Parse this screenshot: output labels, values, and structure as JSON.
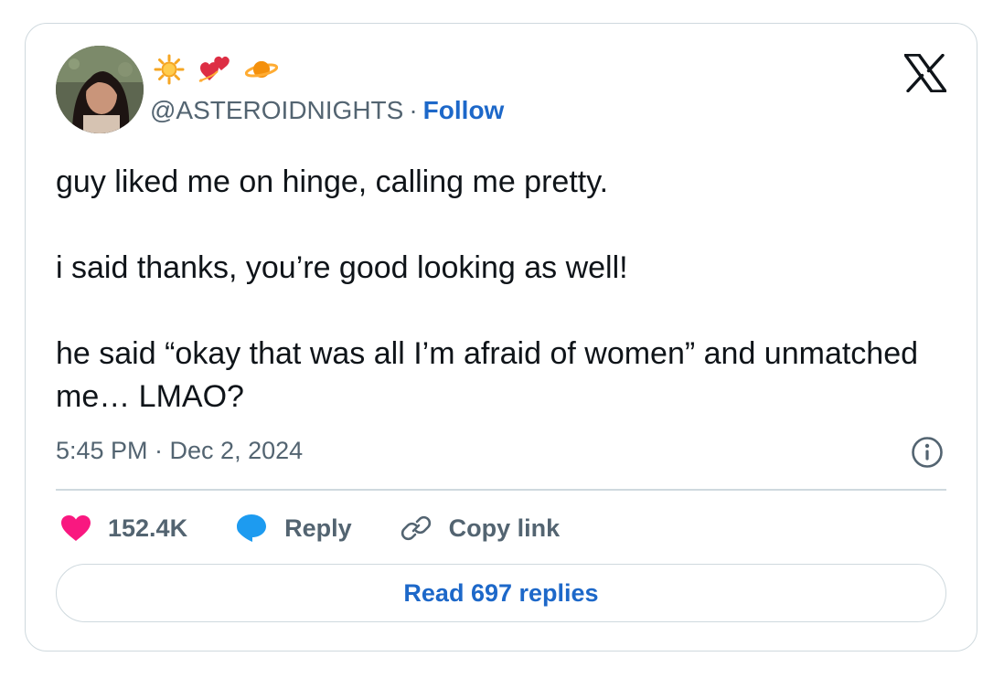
{
  "author": {
    "handle": "@ASTEROIDNIGHTS",
    "separator": "·",
    "follow_label": "Follow",
    "name_emojis": [
      "sun-icon",
      "sparkling-heart-icon",
      "ringed-planet-icon"
    ]
  },
  "tweet": {
    "paragraphs": [
      "guy liked me on hinge, calling me pretty.",
      "i said thanks, you’re good looking as well!",
      "he said “okay that was all I’m afraid of women” and unmatched me… LMAO?"
    ],
    "timestamp": "5:45 PM · Dec 2, 2024"
  },
  "actions": {
    "like_count": "152.4K",
    "reply_label": "Reply",
    "copy_link_label": "Copy link"
  },
  "read_replies_label": "Read 697 replies",
  "colors": {
    "like": "#f91880",
    "reply": "#1d9bf0",
    "link": "#1d68c9",
    "muted": "#536471",
    "border": "#cfd9de"
  }
}
